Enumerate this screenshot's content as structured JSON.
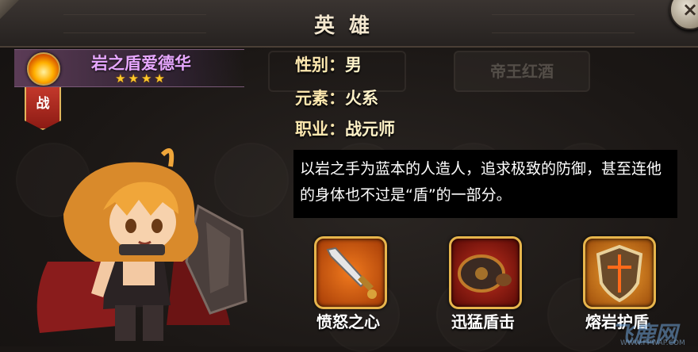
{
  "window": {
    "title": "英雄",
    "close_glyph": "×"
  },
  "hero": {
    "element_icon": "fire-element-icon",
    "name": "岩之盾爱德华",
    "stars": "★★★★",
    "star_count": 4,
    "class_badge": "战"
  },
  "background": {
    "button_label": "帝王红酒"
  },
  "info": {
    "gender_label": "性别：",
    "gender_value": "男",
    "element_label": "元素：",
    "element_value": "火系",
    "job_label": "职业：",
    "job_value": "战元师"
  },
  "description": "以岩之手为蓝本的人造人，追求极致的防御，甚至连他的身体也不过是“盾”的一部分。",
  "skills": [
    {
      "name": "愤怒之心",
      "icon": "sword-icon"
    },
    {
      "name": "迅猛盾击",
      "icon": "shield-bash-icon"
    },
    {
      "name": "熔岩护盾",
      "icon": "lava-shield-icon"
    }
  ],
  "watermark": {
    "text": "飞鹿网",
    "sub": "WWW.FPWAP.COM"
  },
  "colors": {
    "accent_gold": "#e7b54c",
    "name_purple": "#e7a7ff",
    "star_yellow": "#ffc82a"
  }
}
